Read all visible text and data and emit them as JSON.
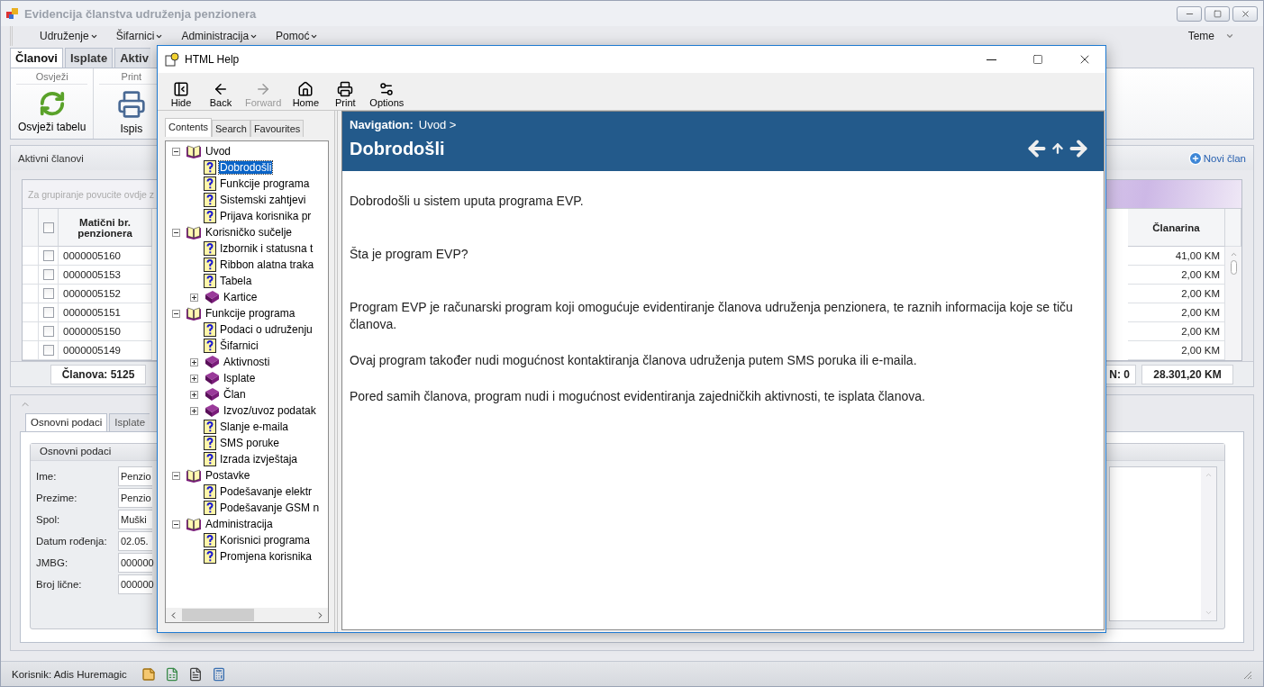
{
  "window": {
    "title": "Evidencija članstva udruženja penzionera"
  },
  "menu": [
    {
      "label": "Udruženje"
    },
    {
      "label": "Šifarnici"
    },
    {
      "label": "Administracija"
    },
    {
      "label": "Pomoć"
    }
  ],
  "theme_menu": {
    "label": "Teme"
  },
  "ribbon_tabs": [
    {
      "label": "Članovi",
      "selected": true
    },
    {
      "label": "Isplate",
      "selected": false
    },
    {
      "label": "Aktiv",
      "selected": false
    }
  ],
  "ribbon_groups": [
    {
      "title": "Osvježi",
      "button": {
        "label": "Osvježi tabelu",
        "kind": "refresh"
      }
    },
    {
      "title": "Print",
      "button": {
        "label": "Ispis",
        "kind": "print"
      }
    }
  ],
  "members": {
    "title": "Aktivni članovi",
    "select_all_checked": false,
    "new_button": "Novi član",
    "group_hint": "Za grupiranje povucite ovdje z",
    "columns": [
      "Matični br. penzionera",
      "Članarina"
    ],
    "rows": [
      {
        "checked": false,
        "number": "0000005160",
        "fee": "41,00 KM"
      },
      {
        "checked": false,
        "number": "0000005153",
        "fee": "2,00 KM"
      },
      {
        "checked": false,
        "number": "0000005152",
        "fee": "2,00 KM"
      },
      {
        "checked": false,
        "number": "0000005151",
        "fee": "2,00 KM"
      },
      {
        "checked": false,
        "number": "0000005150",
        "fee": "2,00 KM"
      },
      {
        "checked": false,
        "number": "0000005149",
        "fee": "2,00 KM"
      }
    ],
    "footer": {
      "count": "Članova: 5125",
      "n": "N: 0",
      "total": "28.301,20 KM"
    }
  },
  "details": {
    "tabs": [
      {
        "label": "Osnovni podaci",
        "selected": true
      },
      {
        "label": "Isplate",
        "selected": false
      }
    ],
    "group_title": "Osnovni podaci",
    "fields": [
      {
        "label": "Ime:",
        "value": "Penzio"
      },
      {
        "label": "Prezime:",
        "value": "Penzio"
      },
      {
        "label": "Spol:",
        "value": "Muški"
      },
      {
        "label": "Datum rođenja:",
        "value": "02.05."
      },
      {
        "label": "JMBG:",
        "value": "000000"
      },
      {
        "label": "Broj lične:",
        "value": "000000"
      }
    ]
  },
  "status_bar": {
    "user": "Korisnik: Adis Huremagic"
  },
  "help": {
    "title": "HTML Help",
    "toolbar": [
      {
        "label": "Hide",
        "kind": "hide",
        "disabled": false
      },
      {
        "label": "Back",
        "kind": "back",
        "disabled": false
      },
      {
        "label": "Forward",
        "kind": "forward",
        "disabled": true
      },
      {
        "label": "Home",
        "kind": "home",
        "disabled": false
      },
      {
        "label": "Print",
        "kind": "print",
        "disabled": false
      },
      {
        "label": "Options",
        "kind": "options",
        "disabled": false
      }
    ],
    "nav_tabs": [
      {
        "label": "Contents",
        "selected": true
      },
      {
        "label": "Search",
        "selected": false
      },
      {
        "label": "Favourites",
        "selected": false
      }
    ],
    "tree": [
      {
        "label": "Uvod",
        "kind": "book",
        "expanded": true,
        "selected": false,
        "children": [
          {
            "label": "Dobrodošli",
            "kind": "page",
            "selected": true
          },
          {
            "label": "Funkcije programa",
            "kind": "page",
            "selected": false
          },
          {
            "label": "Sistemski zahtjevi",
            "kind": "page",
            "selected": false
          },
          {
            "label": "Prijava korisnika pr",
            "kind": "page",
            "selected": false
          }
        ]
      },
      {
        "label": "Korisničko sučelje",
        "kind": "book",
        "expanded": true,
        "selected": false,
        "children": [
          {
            "label": "Izbornik i statusna t",
            "kind": "page",
            "selected": false
          },
          {
            "label": "Ribbon alatna traka",
            "kind": "page",
            "selected": false
          },
          {
            "label": "Tabela",
            "kind": "page",
            "selected": false
          },
          {
            "label": "Kartice",
            "kind": "book",
            "expanded": false,
            "selected": false
          }
        ]
      },
      {
        "label": "Funkcije programa",
        "kind": "book",
        "expanded": true,
        "selected": false,
        "children": [
          {
            "label": "Podaci o udruženju",
            "kind": "page",
            "selected": false
          },
          {
            "label": "Šifarnici",
            "kind": "page",
            "selected": false
          },
          {
            "label": "Aktivnosti",
            "kind": "book",
            "expanded": false,
            "selected": false
          },
          {
            "label": "Isplate",
            "kind": "book",
            "expanded": false,
            "selected": false
          },
          {
            "label": "Član",
            "kind": "book",
            "expanded": false,
            "selected": false
          },
          {
            "label": "Izvoz/uvoz podatak",
            "kind": "book",
            "expanded": false,
            "selected": false
          },
          {
            "label": "Slanje e-maila",
            "kind": "page",
            "selected": false
          },
          {
            "label": "SMS poruke",
            "kind": "page",
            "selected": false
          },
          {
            "label": "Izrada izvještaja",
            "kind": "page",
            "selected": false
          }
        ]
      },
      {
        "label": "Postavke",
        "kind": "book",
        "expanded": true,
        "selected": false,
        "children": [
          {
            "label": "Podešavanje elektr",
            "kind": "page",
            "selected": false
          },
          {
            "label": "Podešavanje GSM n",
            "kind": "page",
            "selected": false
          }
        ]
      },
      {
        "label": "Administracija",
        "kind": "book",
        "expanded": true,
        "selected": false,
        "children": [
          {
            "label": "Korisnici programa",
            "kind": "page",
            "selected": false
          },
          {
            "label": "Promjena korisnika",
            "kind": "page",
            "selected": false
          }
        ]
      }
    ],
    "content": {
      "nav_label": "Navigation:",
      "nav_path": "Uvod >",
      "heading": "Dobrodošli",
      "paragraphs": [
        "Dobrodošli u sistem uputa programa EVP.",
        "Šta je program EVP?",
        "Program EVP je računarski program koji omogućuje evidentiranje članova udruženja penzionera, te raznih informacija koje se tiču članova.",
        "Ovaj program također nudi mogućnost kontaktiranja članova udruženja putem SMS poruka ili e-maila.",
        "Pored samih članova, program nudi i mogućnost evidentiranja zajedničkih aktivnosti, te isplata članova."
      ]
    }
  }
}
